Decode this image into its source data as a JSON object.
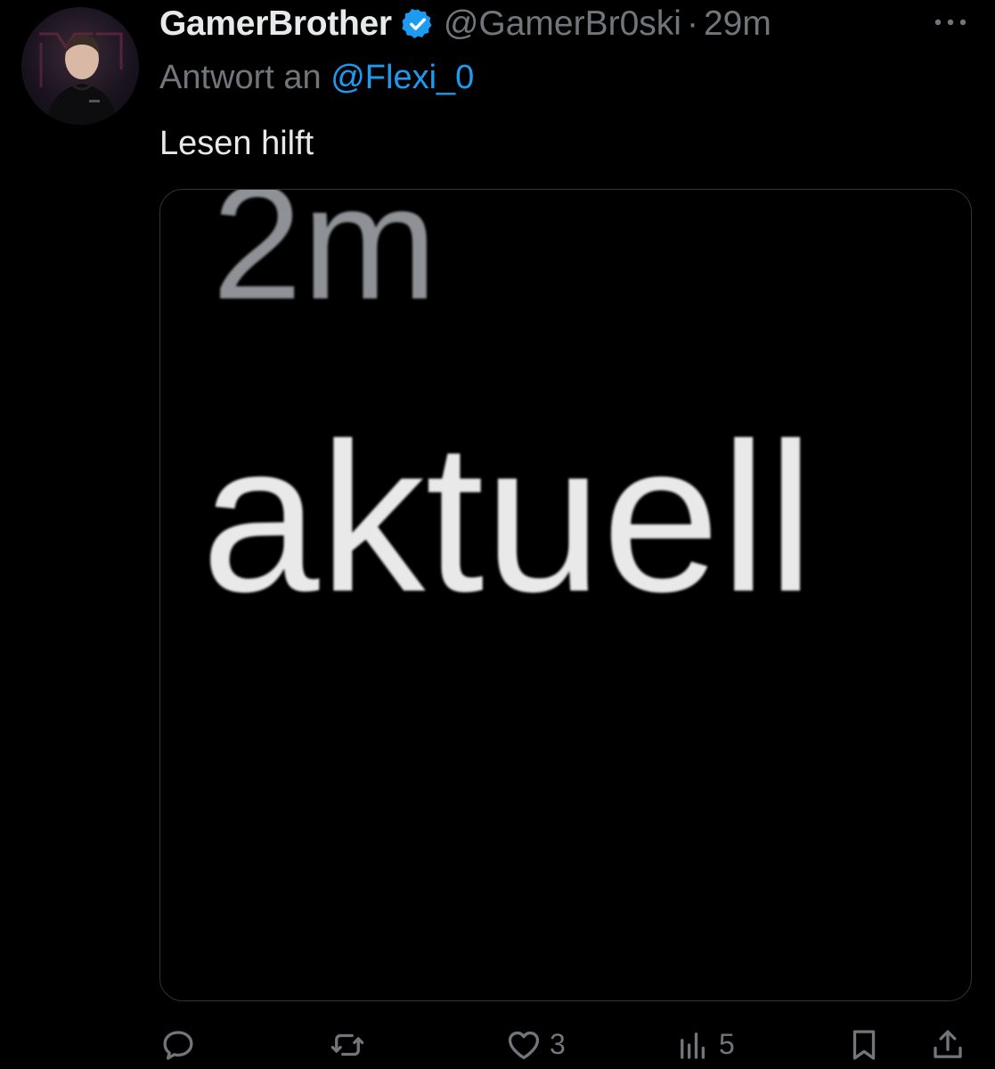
{
  "tweet": {
    "author": {
      "display_name": "GamerBrother",
      "handle": "@GamerBr0ski",
      "verified": true
    },
    "separator": "·",
    "timestamp": "29m",
    "reply_prefix": "Antwort an",
    "reply_to": "@Flexi_0",
    "text": "Lesen hilft",
    "media": {
      "text_top": "2m",
      "text_main": "aktuell"
    }
  },
  "actions": {
    "reply": {
      "icon": "reply-icon",
      "count": ""
    },
    "retweet": {
      "icon": "retweet-icon",
      "count": ""
    },
    "like": {
      "icon": "heart-icon",
      "count": "3"
    },
    "views": {
      "icon": "views-icon",
      "count": "5"
    },
    "bookmark": {
      "icon": "bookmark-icon"
    },
    "share": {
      "icon": "share-icon"
    }
  },
  "colors": {
    "background": "#000000",
    "primary_text": "#e7e9ea",
    "secondary_text": "#71767b",
    "accent": "#1d9bf0",
    "border": "#2f3336"
  }
}
